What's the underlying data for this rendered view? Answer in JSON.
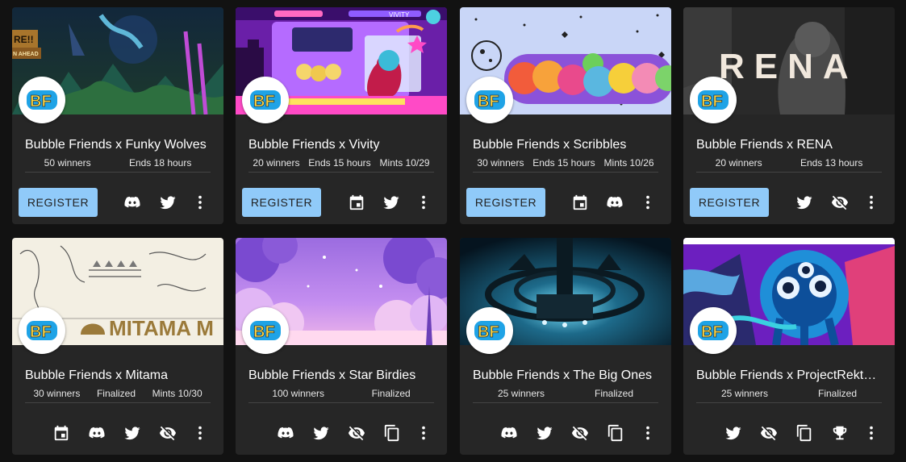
{
  "avatar_text": "BF",
  "register_label": "REGISTER",
  "icons": [
    "discord-icon",
    "twitter-icon",
    "calendar-icon",
    "eye-off-icon",
    "copy-icon",
    "trophy-icon",
    "more-vert-icon"
  ],
  "colors": {
    "accent": "#90caf9",
    "card": "#262626",
    "background": "#121212",
    "avatar_blue": "#1fa3e6",
    "avatar_yellow": "#ffd33d"
  },
  "cards": [
    {
      "title": "Bubble Friends x Funky Wolves",
      "meta": [
        "50 winners",
        "Ends 18 hours"
      ],
      "register": true,
      "icons": [
        "discord-icon",
        "twitter-icon",
        "more-vert-icon"
      ],
      "banner_text": "RE!!",
      "banner_text2": "N AHEAD"
    },
    {
      "title": "Bubble Friends x Vivity",
      "meta": [
        "20 winners",
        "Ends 15 hours",
        "Mints 10/29"
      ],
      "register": true,
      "icons": [
        "calendar-icon",
        "twitter-icon",
        "more-vert-icon"
      ],
      "banner_text": "VIVITY"
    },
    {
      "title": "Bubble Friends x Scribbles",
      "meta": [
        "30 winners",
        "Ends 15 hours",
        "Mints 10/26"
      ],
      "register": true,
      "icons": [
        "calendar-icon",
        "discord-icon",
        "more-vert-icon"
      ]
    },
    {
      "title": "Bubble Friends x RENA",
      "meta": [
        "20 winners",
        "Ends 13 hours"
      ],
      "register": true,
      "icons": [
        "twitter-icon",
        "eye-off-icon",
        "more-vert-icon"
      ],
      "banner_text": "RENA"
    },
    {
      "title": "Bubble Friends x Mitama",
      "meta": [
        "30 winners",
        "Finalized",
        "Mints 10/30"
      ],
      "register": false,
      "icons": [
        "calendar-icon",
        "discord-icon",
        "twitter-icon",
        "eye-off-icon",
        "more-vert-icon"
      ],
      "banner_text": "MITAMA M"
    },
    {
      "title": "Bubble Friends x Star Birdies",
      "meta": [
        "100 winners",
        "Finalized"
      ],
      "register": false,
      "icons": [
        "discord-icon",
        "twitter-icon",
        "eye-off-icon",
        "copy-icon",
        "more-vert-icon"
      ]
    },
    {
      "title": "Bubble Friends x The Big Ones",
      "meta": [
        "25 winners",
        "Finalized"
      ],
      "register": false,
      "icons": [
        "discord-icon",
        "twitter-icon",
        "eye-off-icon",
        "copy-icon",
        "more-vert-icon"
      ]
    },
    {
      "title": "Bubble Friends x ProjectRekt…",
      "meta": [
        "25 winners",
        "Finalized"
      ],
      "register": false,
      "icons": [
        "twitter-icon",
        "eye-off-icon",
        "copy-icon",
        "trophy-icon",
        "more-vert-icon"
      ]
    }
  ]
}
